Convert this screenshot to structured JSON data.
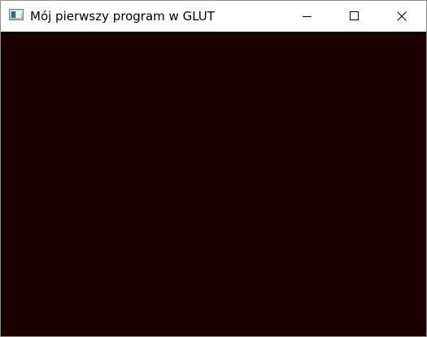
{
  "window": {
    "title": "Mój pierwszy program w GLUT",
    "app_icon": "window-app-icon",
    "controls": {
      "minimize_icon": "minimize-icon",
      "maximize_icon": "maximize-icon",
      "close_icon": "close-icon"
    }
  },
  "colors": {
    "titlebar_background": "#ffffff",
    "client_background": "#1a0000",
    "border": "#8c8c8c"
  }
}
